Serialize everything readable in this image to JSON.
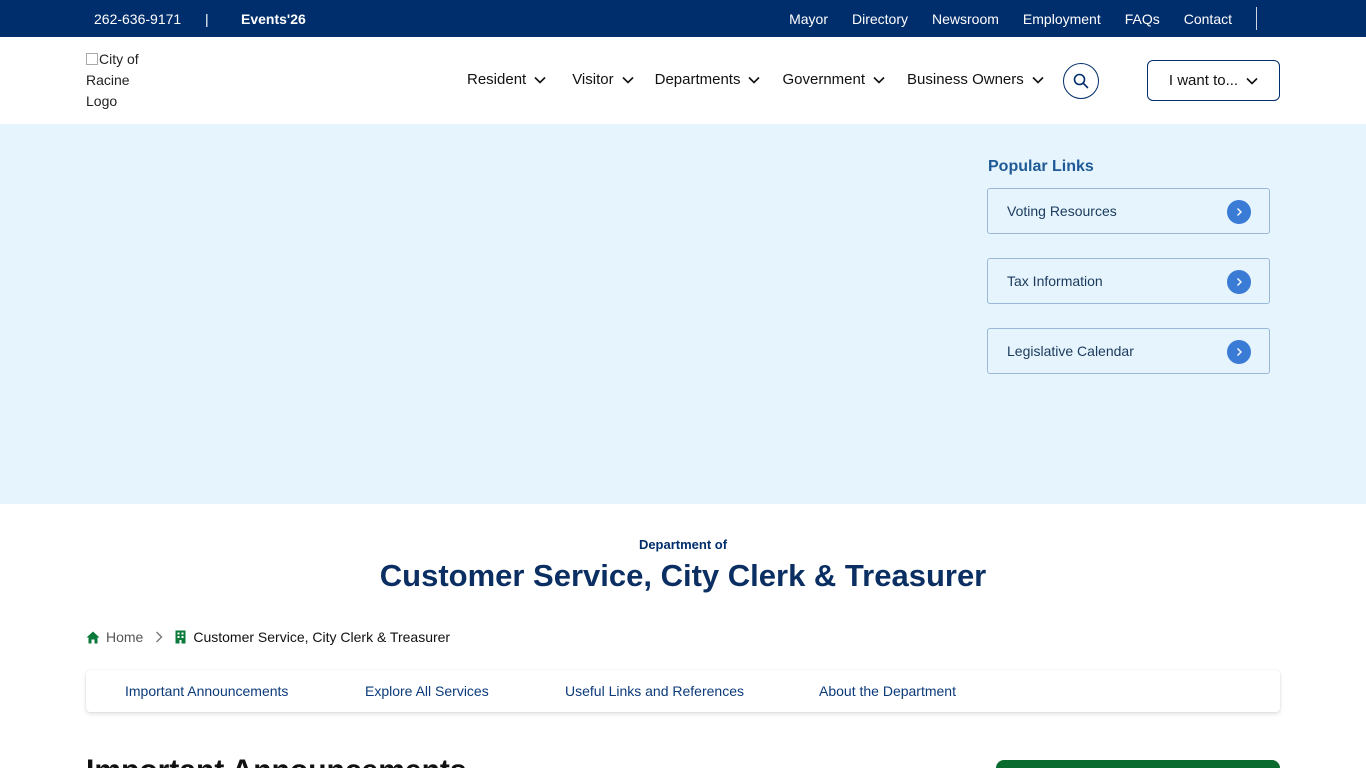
{
  "topbar": {
    "phone": "262-636-9171",
    "separator": "|",
    "events": "Events'26",
    "links": [
      "Mayor",
      "Directory",
      "Newsroom",
      "Employment",
      "FAQs",
      "Contact"
    ]
  },
  "header": {
    "logo_alt": "City of Racine Logo",
    "nav": [
      "Resident",
      "Visitor",
      "Departments",
      "Government",
      "Business Owners"
    ],
    "i_want_to": "I want to..."
  },
  "popular": {
    "title": "Popular Links",
    "items": [
      "Voting Resources",
      "Tax Information",
      "Legislative Calendar"
    ]
  },
  "department": {
    "prefix": "Department of",
    "title": "Customer Service, City Clerk & Treasurer"
  },
  "breadcrumb": {
    "home": "Home",
    "current": "Customer Service, City Clerk & Treasurer"
  },
  "tabs": [
    "Important Announcements",
    "Explore All Services",
    "Useful Links and References",
    "About the Department"
  ],
  "section": {
    "heading": "Important Announcements"
  },
  "colors": {
    "navy": "#002d6b",
    "hero_bg": "#e5f4fd",
    "accent_blue": "#3a7bd5",
    "green": "#0a6b2e"
  }
}
